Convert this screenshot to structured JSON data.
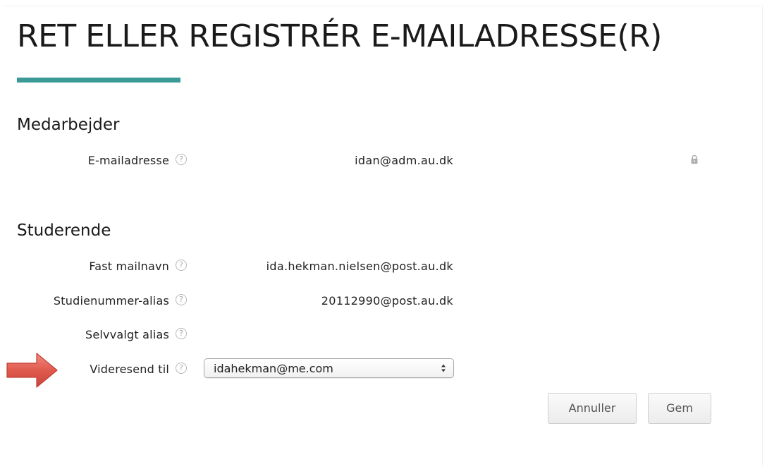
{
  "page": {
    "title": "RET ELLER REGISTRÉR E-MAILADRESSE(R)"
  },
  "colors": {
    "accent": "#3a9a98",
    "pointer_arrow": "#e05a4e"
  },
  "staff": {
    "heading": "Medarbejder",
    "email_label": "E-mailadresse",
    "email_value": "idan@adm.au.dk",
    "email_locked": true
  },
  "student": {
    "heading": "Studerende",
    "fixed_name_label": "Fast mailnavn",
    "fixed_name_value": "ida.hekman.nielsen@post.au.dk",
    "student_number_label": "Studienummer-alias",
    "student_number_value": "20112990@post.au.dk",
    "custom_alias_label": "Selvvalgt alias",
    "custom_alias_value": "",
    "forward_label": "Videresend til",
    "forward_selected": "idahekman@me.com"
  },
  "icons": {
    "help": "?",
    "help_name": "help-icon",
    "lock_name": "lock-icon",
    "pointer_name": "pointer-arrow-icon"
  },
  "actions": {
    "cancel_label": "Annuller",
    "save_label": "Gem"
  }
}
